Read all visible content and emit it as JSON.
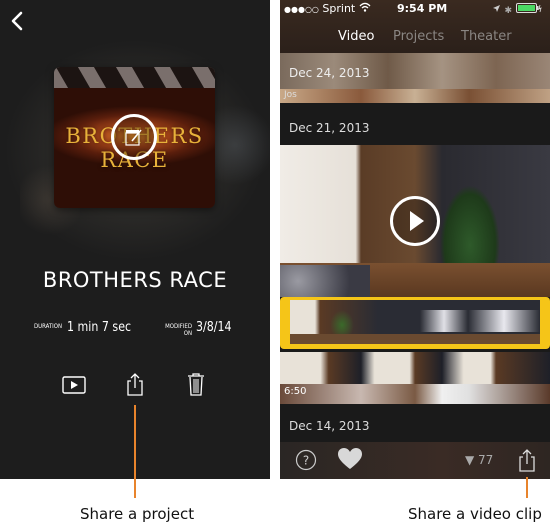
{
  "left_screen": {
    "back_label": "<",
    "thumbnail_title_line1": "BROTHERS",
    "thumbnail_title_line2": "RACE",
    "project_title": "BROTHERS RACE",
    "duration_label": "DURATION",
    "duration_value": "1 min 7 sec",
    "modified_label_1": "MODIFIED",
    "modified_label_2": "ON",
    "modified_value": "3/8/14",
    "actions": [
      {
        "name": "play-icon"
      },
      {
        "name": "share-icon"
      },
      {
        "name": "trash-icon"
      }
    ]
  },
  "right_screen": {
    "status_bar": {
      "signal": "●●●○○",
      "carrier": "Sprint",
      "time": "9:54 PM"
    },
    "tabs": [
      {
        "label": "Video",
        "active": true
      },
      {
        "label": "Projects",
        "active": false
      },
      {
        "label": "Theater",
        "active": false
      }
    ],
    "sections": [
      {
        "date": "Dec 24, 2013",
        "clip_label": "Jos"
      },
      {
        "date": "Dec 21, 2013",
        "clip_duration": "6:50"
      },
      {
        "date": "Dec 14, 2013"
      }
    ],
    "footer": {
      "filter_count": "▼ 77"
    },
    "colors": {
      "selection": "#f5c518",
      "tab_active": "#ffffff",
      "tab_inactive": "#8a8683"
    }
  },
  "callouts": {
    "left": "Share a project",
    "right": "Share a video clip",
    "color": "#e8842c"
  }
}
